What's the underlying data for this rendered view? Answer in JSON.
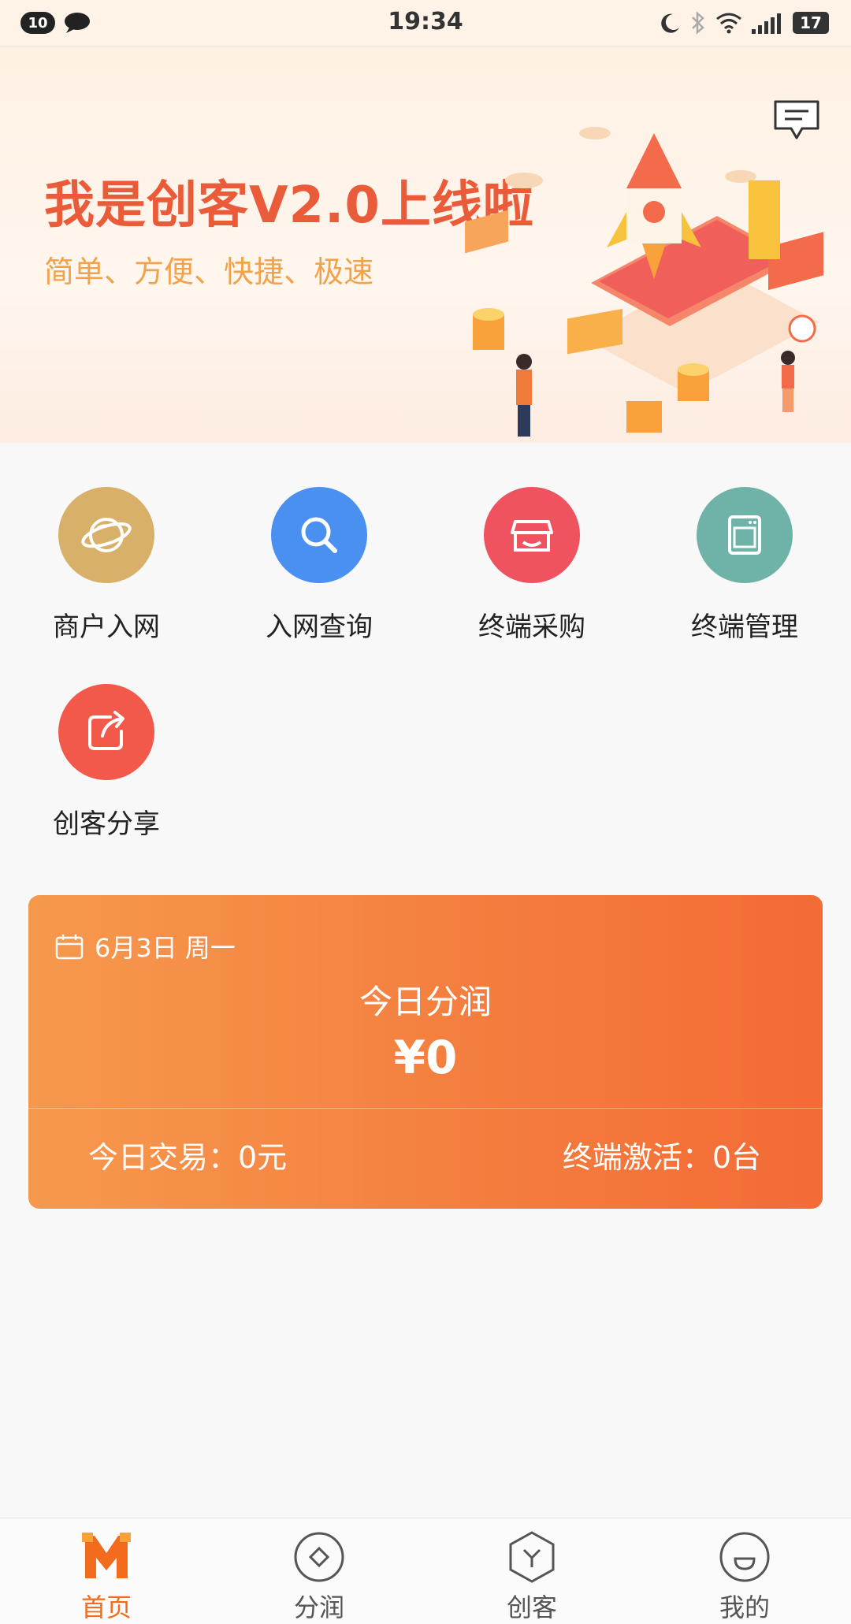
{
  "status_bar": {
    "notification_count": "10",
    "time": "19:34",
    "battery": "17"
  },
  "banner": {
    "title": "我是创客V2.0上线啦",
    "subtitle": "简单、方便、快捷、极速"
  },
  "actions": [
    {
      "label": "商户入网",
      "icon": "planet-icon",
      "color": "#d9b06a"
    },
    {
      "label": "入网查询",
      "icon": "search-icon",
      "color": "#4a90f0"
    },
    {
      "label": "终端采购",
      "icon": "store-icon",
      "color": "#ef5360"
    },
    {
      "label": "终端管理",
      "icon": "device-icon",
      "color": "#6fb3a8"
    },
    {
      "label": "创客分享",
      "icon": "share-icon",
      "color": "#f2594b"
    }
  ],
  "earnings_card": {
    "date": "6月3日 周一",
    "title": "今日分润",
    "amount": "¥0",
    "today_trade": "今日交易：0元",
    "terminal_activation": "终端激活：0台"
  },
  "bottom_nav": [
    {
      "label": "首页",
      "active": true
    },
    {
      "label": "分润",
      "active": false
    },
    {
      "label": "创客",
      "active": false
    },
    {
      "label": "我的",
      "active": false
    }
  ],
  "colors": {
    "accent": "#f36b1c",
    "card_start": "#f6994d",
    "card_end": "#f36b35"
  }
}
